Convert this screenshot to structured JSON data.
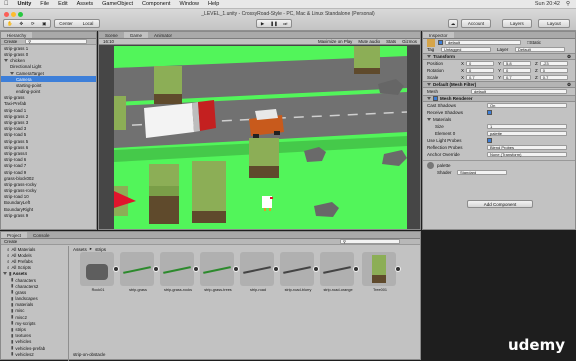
{
  "menubar": {
    "apple": "",
    "items": [
      "Unity",
      "File",
      "Edit",
      "Assets",
      "GameObject",
      "Component",
      "Window",
      "Help"
    ],
    "status": [
      "Sun 20:42",
      "Q"
    ]
  },
  "toolbar": {
    "pivot_label": "Center",
    "space_label": "Local",
    "title": "_LEVEL_1.unity - CrossyRoad-Style - PC, Mac & Linux Standalone (Personal)",
    "account_label": "Account",
    "layers_label": "Layers",
    "layout_label": "Layout"
  },
  "hierarchy": {
    "tab": "Hierarchy",
    "create_label": "Create",
    "items": [
      {
        "label": "strip-grass 1",
        "indent": 0,
        "selected": false,
        "arrow": false
      },
      {
        "label": "strip-grass 0",
        "indent": 0,
        "selected": false,
        "arrow": false
      },
      {
        "label": "chicken",
        "indent": 0,
        "selected": false,
        "arrow": true
      },
      {
        "label": "Directional Light",
        "indent": 1,
        "selected": false,
        "arrow": false
      },
      {
        "label": "CameraTarget",
        "indent": 1,
        "selected": false,
        "arrow": true
      },
      {
        "label": "Camera",
        "indent": 2,
        "selected": true,
        "arrow": false
      },
      {
        "label": "starting-point",
        "indent": 2,
        "selected": false,
        "arrow": false
      },
      {
        "label": "ending-point",
        "indent": 2,
        "selected": false,
        "arrow": false
      },
      {
        "label": "strip-grass",
        "indent": 0,
        "selected": false,
        "arrow": false
      },
      {
        "label": "Taxi-Prefab",
        "indent": 0,
        "selected": false,
        "arrow": false
      },
      {
        "label": "strip-road 1",
        "indent": 0,
        "selected": false,
        "arrow": false
      },
      {
        "label": "strip-grass 2",
        "indent": 0,
        "selected": false,
        "arrow": false
      },
      {
        "label": "strip-grass 3",
        "indent": 0,
        "selected": false,
        "arrow": false
      },
      {
        "label": "strip-road 3",
        "indent": 0,
        "selected": false,
        "arrow": false
      },
      {
        "label": "strip-road 5",
        "indent": 0,
        "selected": false,
        "arrow": false
      },
      {
        "label": "strip-grass 5",
        "indent": 0,
        "selected": false,
        "arrow": false
      },
      {
        "label": "strip-grass 6",
        "indent": 0,
        "selected": false,
        "arrow": false
      },
      {
        "label": "strip-grass4",
        "indent": 0,
        "selected": false,
        "arrow": false
      },
      {
        "label": "strip-road 6",
        "indent": 0,
        "selected": false,
        "arrow": false
      },
      {
        "label": "strip-road 7",
        "indent": 0,
        "selected": false,
        "arrow": false
      },
      {
        "label": "strip-road 9",
        "indent": 0,
        "selected": false,
        "arrow": false
      },
      {
        "label": "grass-block002",
        "indent": 0,
        "selected": false,
        "arrow": false
      },
      {
        "label": "strip-grass-rocky",
        "indent": 0,
        "selected": false,
        "arrow": false
      },
      {
        "label": "strip-grass-rocky",
        "indent": 0,
        "selected": false,
        "arrow": false
      },
      {
        "label": "strip-road 10",
        "indent": 0,
        "selected": false,
        "arrow": false
      },
      {
        "label": "BoundaryLeft",
        "indent": 0,
        "selected": false,
        "arrow": false
      },
      {
        "label": "BoundaryRight",
        "indent": 0,
        "selected": false,
        "arrow": false
      },
      {
        "label": "strip-grass 9",
        "indent": 0,
        "selected": false,
        "arrow": false
      }
    ]
  },
  "scene_tabs": [
    "Scene",
    "Game",
    "Animator"
  ],
  "game_bar": {
    "display": "16:10",
    "options": [
      "Maximize on Play",
      "Mute audio",
      "Stats",
      "Gizmos"
    ]
  },
  "inspector": {
    "tab": "Inspector",
    "object_name": "default",
    "static_label": "Static",
    "tag_label": "Tag",
    "tag_value": "Untagged",
    "layer_label": "Layer",
    "layer_value": "Default",
    "transform": {
      "title": "Transform",
      "rows": [
        {
          "label": "Position",
          "x": "0",
          "y": "5.8",
          "z": "-23"
        },
        {
          "label": "Rotation",
          "x": "0",
          "y": "0",
          "z": "0"
        },
        {
          "label": "Scale",
          "x": "0.7",
          "y": "0.7",
          "z": "0.7"
        }
      ]
    },
    "mesh_filter": {
      "title": "Default (Mesh Filter)",
      "mesh_label": "Mesh",
      "mesh_value": "default"
    },
    "mesh_renderer": {
      "title": "Mesh Renderer",
      "cast_label": "Cast Shadows",
      "cast_value": "On",
      "receive_label": "Receive Shadows",
      "materials_label": "Materials",
      "size_label": "Size",
      "size_value": "1",
      "element_label": "Element 0",
      "element_value": "palette",
      "probes_label": "Use Light Probes",
      "reflection_label": "Reflection Probes",
      "reflection_value": "Blend Probes",
      "anchor_label": "Anchor Override",
      "anchor_value": "None (Transform)"
    },
    "material": {
      "name": "palette",
      "shader_label": "Shader",
      "shader_value": "Standard"
    },
    "add_component_label": "Add Component"
  },
  "project": {
    "tabs": [
      "Project",
      "Console"
    ],
    "create_label": "Create",
    "favorites": [
      "All Materials",
      "All Models",
      "All Prefabs",
      "All Scripts"
    ],
    "folders_root": "Assets",
    "folders": [
      "characters",
      "characters2",
      "grass",
      "landscapes",
      "materials",
      "misc",
      "misc2",
      "my-scripts",
      "strips",
      "textures",
      "vehicles",
      "vehicles-prefab",
      "vehicles2"
    ],
    "breadcrumb_root": "Assets",
    "breadcrumb_current": "strips",
    "assets": [
      "Rock01",
      "strip-grass",
      "strip-grass-rocks",
      "strip-grass-trees",
      "strip-road",
      "strip-road-blurry",
      "strip-road-orange",
      "Tree001"
    ],
    "footer_file": "strip-on-obstacle"
  },
  "watermark": "udemy",
  "colors": {
    "selection": "#3d7fd9",
    "grass": "#52f55a",
    "road": "#6f6f6f"
  }
}
